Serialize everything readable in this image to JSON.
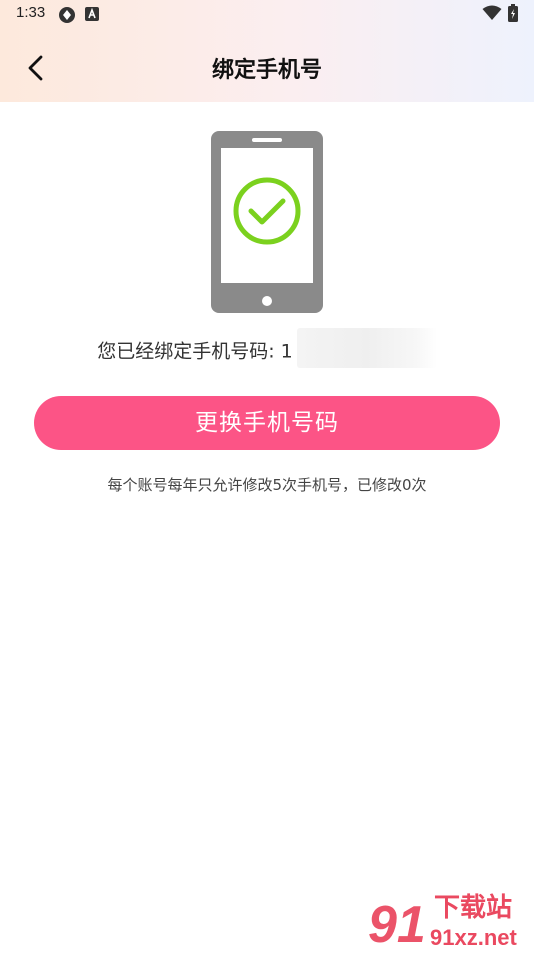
{
  "status_bar": {
    "time": "1:33",
    "icons": [
      "sync-status-icon",
      "a-notification-icon",
      "wifi-icon",
      "battery-icon"
    ]
  },
  "nav": {
    "title": "绑定手机号",
    "back_icon": "chevron-left-icon"
  },
  "content": {
    "illustration_icon": "phone-check-icon",
    "bound_label": "您已经绑定手机号码: ",
    "bound_number_prefix": "1",
    "change_button_label": "更换手机号码",
    "limit_note": "每个账号每年只允许修改5次手机号，已修改0次"
  },
  "watermark": {
    "logo_text": "91",
    "brand_text": "下载站",
    "domain_text": "91xz.net"
  },
  "colors": {
    "accent": "#fc5486",
    "check": "#7bd11e",
    "phone_body": "#8a8a8a",
    "watermark": "#e8364f"
  }
}
